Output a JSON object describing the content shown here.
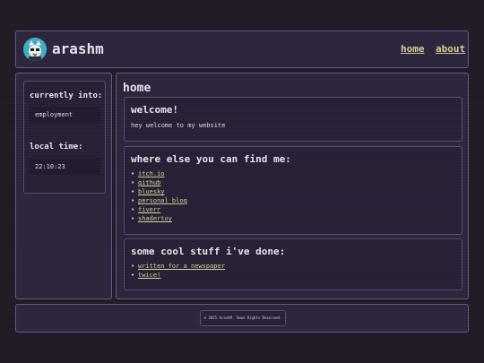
{
  "header": {
    "site_title": "arashm",
    "nav": [
      {
        "label": "home"
      },
      {
        "label": "about"
      }
    ]
  },
  "sidebar": {
    "currently_into_heading": "currently into:",
    "currently_into_value": "employment",
    "local_time_heading": "local time:",
    "local_time_value": "22:10:23"
  },
  "main": {
    "page_title": "home",
    "welcome": {
      "title": "welcome!",
      "text": "hey welcome to my website"
    },
    "find_me": {
      "title": "where else you can find me:",
      "links": [
        "itch.io",
        "github",
        "bluesky",
        "personal blog",
        "fiverr",
        "shadertoy"
      ]
    },
    "stuff": {
      "title": "some cool stuff i've done:",
      "links": [
        "written for a newspaper",
        "twice!"
      ]
    }
  },
  "footer": {
    "text": "© 2025 ArashM. Some Rights Reserved."
  },
  "colors": {
    "background": "#241d28",
    "panel": "#2f2740",
    "border": "#6b5a86",
    "link": "#d9d79a",
    "logo": "#3fb4c9"
  }
}
